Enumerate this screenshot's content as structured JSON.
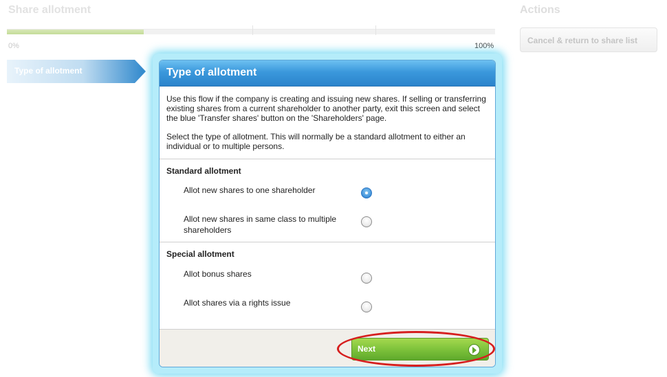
{
  "page": {
    "title": "Share allotment",
    "actions_title": "Actions"
  },
  "progress": {
    "start_label": "0%",
    "end_label": "100%",
    "fraction": 0.28
  },
  "actions": {
    "cancel_label": "Cancel & return to share list"
  },
  "steps": [
    {
      "label": "Type of allotment",
      "active": true
    }
  ],
  "modal": {
    "title": "Type of allotment",
    "intro_1": "Use this flow if the company is creating and issuing new shares. If selling or transferring existing shares from a current shareholder to another party, exit this screen and select the blue 'Transfer shares' button on the 'Shareholders' page.",
    "intro_2": "Select the type of allotment. This will normally be a standard allotment to either an individual or to multiple persons.",
    "sections": [
      {
        "title": "Standard allotment",
        "options": [
          {
            "label": "Allot new shares to one shareholder",
            "checked": true
          },
          {
            "label": "Allot new shares in same class to multiple shareholders",
            "checked": false
          }
        ]
      },
      {
        "title": "Special allotment",
        "options": [
          {
            "label": "Allot bonus shares",
            "checked": false
          },
          {
            "label": "Allot shares via a rights issue",
            "checked": false
          }
        ]
      }
    ],
    "next_label": "Next"
  },
  "colors": {
    "header_blue": "#3b98dc",
    "next_green": "#82c53d",
    "highlight_red": "#d61e1e"
  }
}
